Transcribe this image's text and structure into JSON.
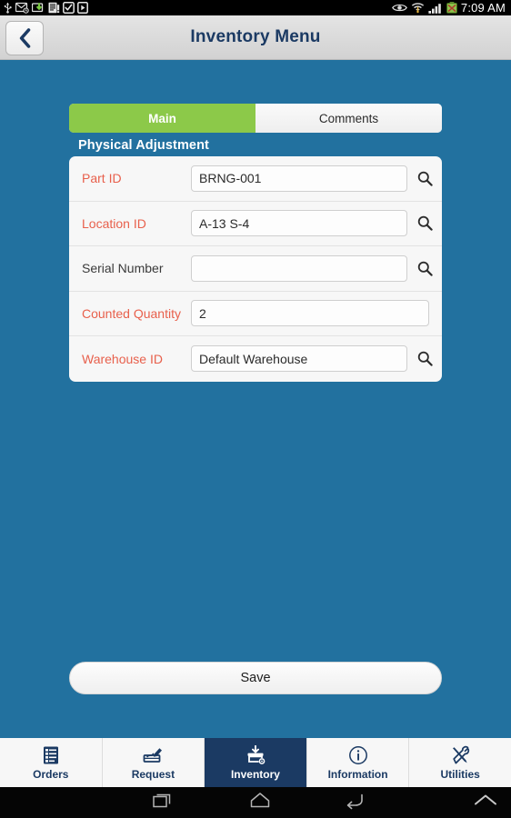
{
  "statusbar": {
    "icons": [
      "usb-icon",
      "email-icon",
      "download-arrow-icon",
      "report-icon",
      "checkbox-icon",
      "screenshot-icon"
    ],
    "right_icons": [
      "eye-icon",
      "wifi-icon",
      "signal-icon",
      "battery-icon"
    ],
    "time": "7:09 AM"
  },
  "titlebar": {
    "back_icon": "chevron-left-icon",
    "title": "Inventory Menu"
  },
  "tabs": [
    {
      "label": "Main",
      "active": true
    },
    {
      "label": "Comments",
      "active": false
    }
  ],
  "section": {
    "title": "Physical Adjustment"
  },
  "form": {
    "rows": [
      {
        "label": "Part ID",
        "required": true,
        "value": "BRNG-001",
        "placeholder": "",
        "search": true
      },
      {
        "label": "Location ID",
        "required": true,
        "value": "A-13 S-4",
        "placeholder": "",
        "search": true
      },
      {
        "label": "Serial Number",
        "required": false,
        "value": "",
        "placeholder": "",
        "search": true
      },
      {
        "label": "Counted Quantity",
        "required": true,
        "value": "2",
        "placeholder": "",
        "search": false
      },
      {
        "label": "Warehouse ID",
        "required": true,
        "value": "Default Warehouse",
        "placeholder": "",
        "search": true
      }
    ],
    "search_icon": "magnifier-icon"
  },
  "save": {
    "label": "Save"
  },
  "appnav": [
    {
      "label": "Orders",
      "icon": "list-document-icon",
      "active": false
    },
    {
      "label": "Request",
      "icon": "sign-pen-icon",
      "active": false
    },
    {
      "label": "Inventory",
      "icon": "inbox-gear-icon",
      "active": true
    },
    {
      "label": "Information",
      "icon": "info-circle-icon",
      "active": false
    },
    {
      "label": "Utilities",
      "icon": "tools-icon",
      "active": false
    }
  ],
  "softkeys": [
    {
      "name": "recent-apps-key"
    },
    {
      "name": "home-key"
    },
    {
      "name": "back-key"
    },
    {
      "name": "expand-up-key"
    }
  ],
  "colors": {
    "body_blue": "#22719f",
    "tab_green": "#8cc949",
    "nav_navy": "#1b3a63",
    "label_red": "#e8604c",
    "card_bg": "#f7f7f7"
  }
}
